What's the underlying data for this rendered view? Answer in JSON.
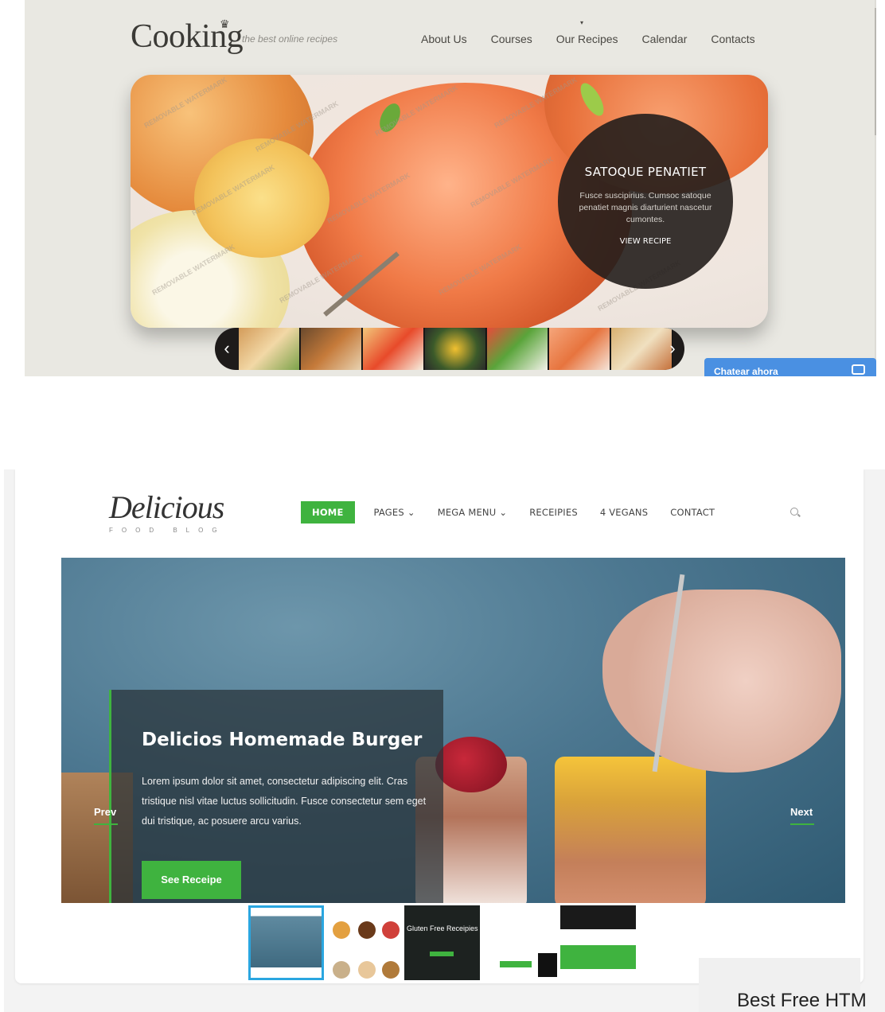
{
  "cooking": {
    "logo": "Cooking",
    "tagline": "the best online recipes",
    "nav": [
      "About Us",
      "Courses",
      "Our Recipes",
      "Calendar",
      "Contacts"
    ],
    "slide": {
      "title": "SATOQUE PENATIET",
      "description": "Fusce suscipirius. Cumsoc satoque penatiet magnis diarturient nascetur cumontes.",
      "cta": "VIEW RECIPE"
    },
    "watermark": "REMOVABLE WATERMARK",
    "chat": "Chatear ahora",
    "icons": {
      "prev": "chevron-left-icon",
      "next": "chevron-right-icon",
      "chat": "chat-icon"
    }
  },
  "delicious": {
    "logo": "Delicious",
    "logo_sub": "FOOD BLOG",
    "nav": {
      "home": "HOME",
      "pages": "PAGES",
      "mega": "MEGA MENU",
      "recipes": "RECEIPIES",
      "vegans": "4 VEGANS",
      "contact": "CONTACT"
    },
    "hero": {
      "title": "Delicios Homemade Burger",
      "description": "Lorem ipsum dolor sit amet, consectetur adipiscing elit. Cras tristique nisl vitae luctus sollicitudin. Fusce consectetur sem eget dui tristique, ac posuere arcu varius.",
      "button": "See Receipe",
      "prev": "Prev",
      "next": "Next"
    },
    "thumb_labels": [
      "Gluten Free Receipies"
    ],
    "overlay_text": "Best Free HTM",
    "accent": "#3fb33f"
  }
}
